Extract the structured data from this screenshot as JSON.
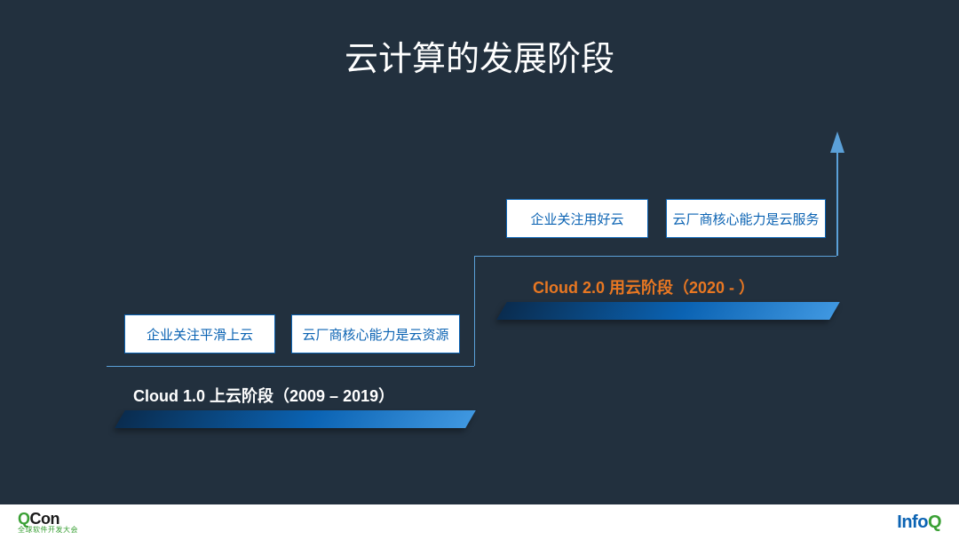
{
  "title": "云计算的发展阶段",
  "stage1": {
    "label": "Cloud 1.0 上云阶段（2009 – 2019）",
    "boxA": "企业关注平滑上云",
    "boxB": "云厂商核心能力是云资源"
  },
  "stage2": {
    "label": "Cloud 2.0 用云阶段（2020 - ）",
    "boxA": "企业关注用好云",
    "boxB": "云厂商核心能力是云服务"
  },
  "footer": {
    "left_brand_q": "Q",
    "left_brand_con": "Con",
    "left_sub": "全球软件开发大会",
    "right_info": "Info",
    "right_q": "Q"
  }
}
